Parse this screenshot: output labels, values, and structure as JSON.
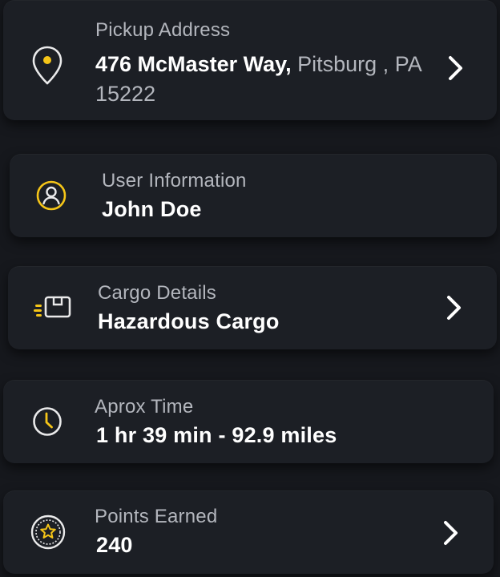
{
  "colors": {
    "background": "#16181d",
    "card": "#1c1f25",
    "accent": "#f5c518",
    "label": "#b3b6bd",
    "value": "#ffffff"
  },
  "pickup": {
    "label": "Pickup Address",
    "street": "476 McMaster Way,",
    "city": "Pitsburg ,",
    "zip": "PA 15222",
    "icon": "location-pin-icon"
  },
  "user": {
    "label": "User Information",
    "value": "John Doe",
    "icon": "user-icon"
  },
  "cargo": {
    "label": "Cargo Details",
    "value": "Hazardous Cargo",
    "icon": "cargo-box-icon"
  },
  "time": {
    "label": "Aprox Time",
    "value": "1 hr 39 min - 92.9 miles",
    "icon": "clock-icon"
  },
  "points": {
    "label": "Points Earned",
    "value": "240",
    "icon": "star-coin-icon"
  }
}
